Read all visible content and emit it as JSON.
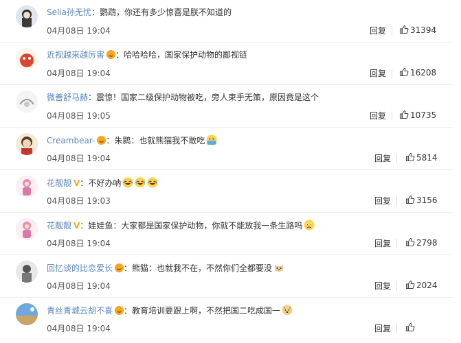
{
  "comments": [
    {
      "username": "Selia孙无忧",
      "name_color": "blue",
      "badge": "",
      "text": "：鹦鹉，你还有多少惊喜是朕不知道的",
      "emojis": [],
      "time": "04月08日 19:04",
      "reply": "回复",
      "likes": "31394"
    },
    {
      "username": "近视越来越厉害",
      "name_color": "blue",
      "badge": "gold",
      "text": "：哈哈哈哈，国家保护动物的鄙视链",
      "emojis": [],
      "time": "04月08日 19:04",
      "reply": "回复",
      "likes": "16208"
    },
    {
      "username": "微善舒马赫",
      "name_color": "blue",
      "badge": "",
      "text": "：震惊！国家二级保护动物被吃，旁人束手无策，原因竟是这个",
      "emojis": [],
      "time": "04月08日 19:05",
      "reply": "回复",
      "likes": "10735"
    },
    {
      "username": "Creambear-",
      "name_color": "blue",
      "badge": "gold",
      "text": "：朱鹮：也就熊猫我不敢吃",
      "emojis": [
        "cry-emoji"
      ],
      "time": "04月08日 19:04",
      "reply": "回复",
      "likes": "5814"
    },
    {
      "username": "花靓靓",
      "name_color": "blue",
      "badge": "v",
      "text": "：不好办呐",
      "emojis": [
        "laugh-cry-emoji",
        "laugh-cry-emoji",
        "laugh-cry-emoji"
      ],
      "time": "04月08日 19:03",
      "reply": "回复",
      "likes": "3156"
    },
    {
      "username": "花靓靓",
      "name_color": "blue",
      "badge": "v",
      "text": "：娃娃鱼：大家都是国家保护动物，你就不能放我一条生路吗",
      "emojis": [
        "sad-emoji"
      ],
      "time": "04月08日 19:04",
      "reply": "回复",
      "likes": "2798"
    },
    {
      "username": "回忆谈的比恋爱长",
      "name_color": "blue",
      "badge": "gold",
      "text": "：熊猫：也就我不在，不然你们全都要没",
      "emojis": [
        "cat-emoji"
      ],
      "time": "04月08日 19:04",
      "reply": "回复",
      "likes": "2024"
    },
    {
      "username": "青丝青城云胡不喜",
      "name_color": "blue",
      "badge": "gold",
      "text": "：教育培训要跟上啊，不然把国二吃成国一",
      "emojis": [
        "doge-emoji"
      ],
      "time": "04月08日 19:04",
      "reply": "回复",
      "likes": ""
    }
  ]
}
